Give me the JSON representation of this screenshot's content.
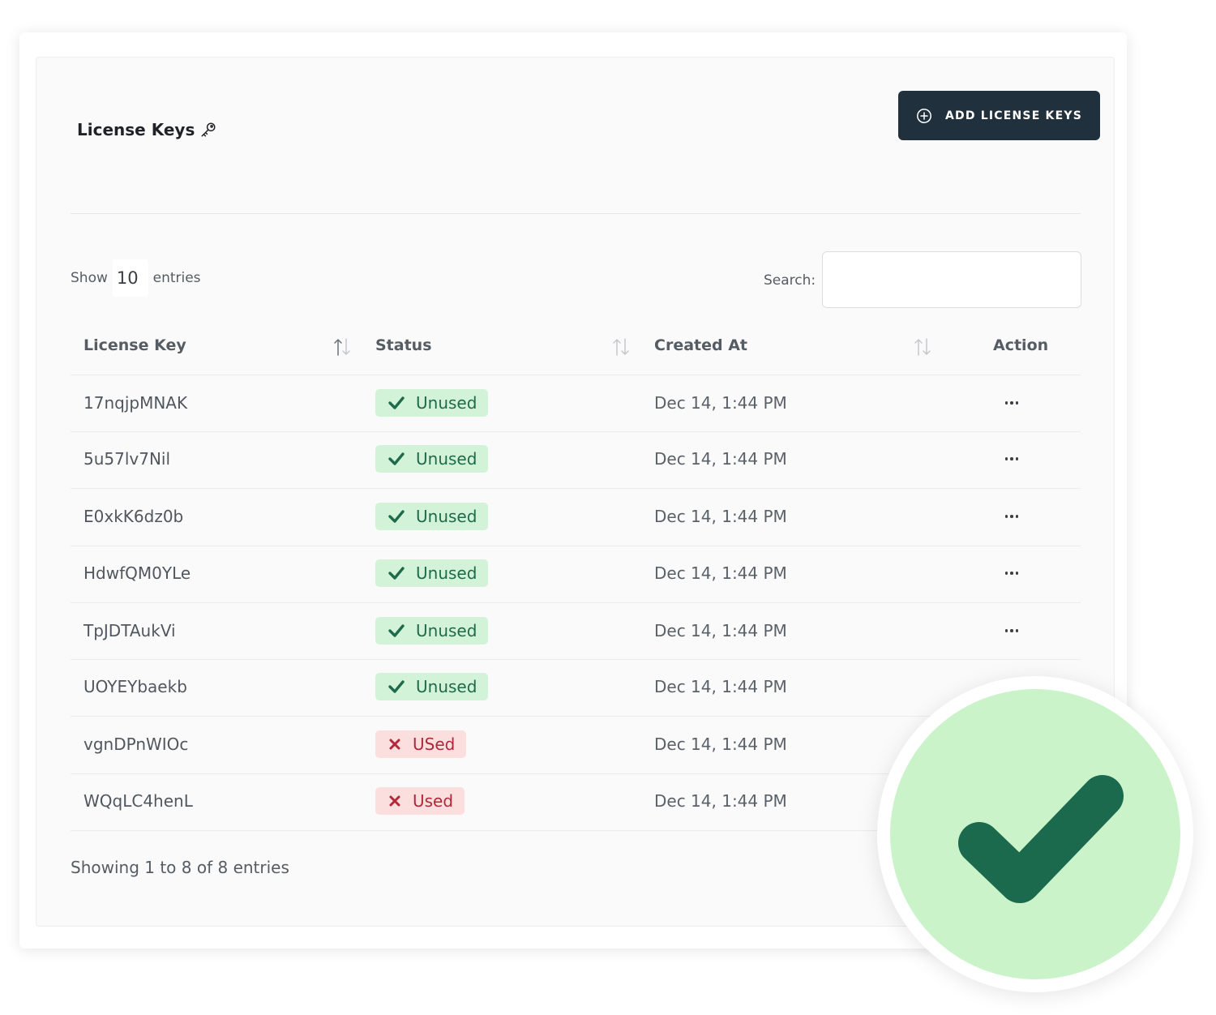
{
  "header": {
    "title": "License Keys",
    "add_button_label": "ADD LICENSE KEYS"
  },
  "controls": {
    "show_label": "Show",
    "page_length": "10",
    "entries_label": "entries",
    "search_label": "Search:",
    "search_value": ""
  },
  "table": {
    "columns": [
      "License Key",
      "Status",
      "Created At",
      "Action"
    ],
    "rows": [
      {
        "key": "17nqjpMNAK",
        "status": "Unused",
        "state": "ok",
        "created": "Dec 14, 1:44 PM"
      },
      {
        "key": "5u57lv7Nil",
        "status": "Unused",
        "state": "ok",
        "created": "Dec 14, 1:44 PM"
      },
      {
        "key": "E0xkK6dz0b",
        "status": "Unused",
        "state": "ok",
        "created": "Dec 14, 1:44 PM"
      },
      {
        "key": "HdwfQM0YLe",
        "status": "Unused",
        "state": "ok",
        "created": "Dec 14, 1:44 PM"
      },
      {
        "key": "TpJDTAukVi",
        "status": "Unused",
        "state": "ok",
        "created": "Dec 14, 1:44 PM"
      },
      {
        "key": "UOYEYbaekb",
        "status": "Unused",
        "state": "ok",
        "created": "Dec 14, 1:44 PM"
      },
      {
        "key": "vgnDPnWIOc",
        "status": "USed",
        "state": "bad",
        "created": "Dec 14, 1:44 PM"
      },
      {
        "key": "WQqLC4henL",
        "status": "Used",
        "state": "bad",
        "created": "Dec 14, 1:44 PM"
      }
    ]
  },
  "footer": {
    "info": "Showing 1 to 8 of 8 entries"
  },
  "icons": {
    "title_icon": "key-icon",
    "add_icon": "plus-circle-icon",
    "sort_icon": "sort-arrows-icon",
    "ok_icon": "check-icon",
    "bad_icon": "x-icon",
    "action_icon": "more-horizontal-icon",
    "overlay_icon": "success-check-icon"
  },
  "colors": {
    "button_bg": "#21303d",
    "ok_bg": "#d3f3d9",
    "ok_fg": "#1e6a4b",
    "bad_bg": "#fbdede",
    "bad_fg": "#b0283a",
    "overlay_circle": "#cbf3c9",
    "overlay_check": "#1b6a4e"
  }
}
